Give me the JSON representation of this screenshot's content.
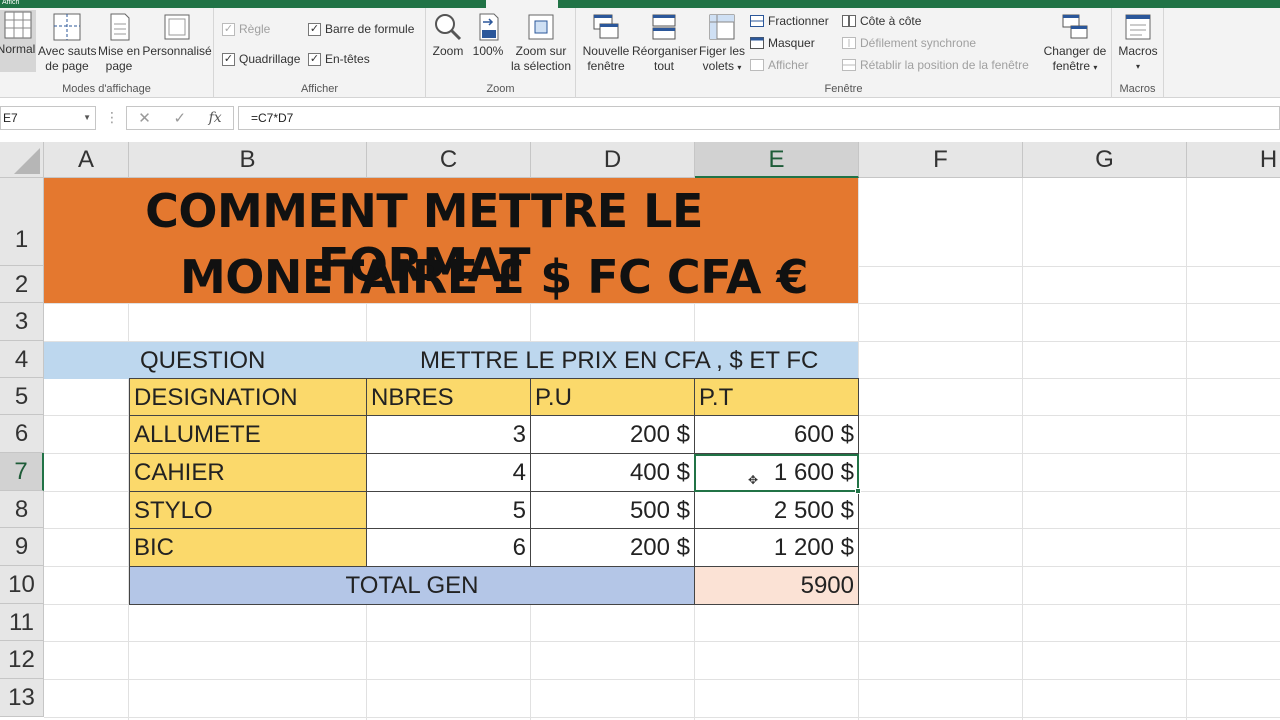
{
  "ribbon": {
    "top_tab_text": "Affich",
    "groups": {
      "modes": {
        "label": "Modes d'affichage",
        "normal": "Normal",
        "sauts_l1": "Avec sauts",
        "sauts_l2": "de page",
        "mise_l1": "Mise en",
        "mise_l2": "page",
        "perso": "Personnalisé"
      },
      "afficher": {
        "label": "Afficher",
        "regle": "Règle",
        "barre_formule": "Barre de formule",
        "quadrillage": "Quadrillage",
        "entetes": "En-têtes"
      },
      "zoom": {
        "label": "Zoom",
        "zoom": "Zoom",
        "cent": "100%",
        "sel_l1": "Zoom sur",
        "sel_l2": "la sélection"
      },
      "fenetre": {
        "label": "Fenêtre",
        "nouvelle_l1": "Nouvelle",
        "nouvelle_l2": "fenêtre",
        "reorg_l1": "Réorganiser",
        "reorg_l2": "tout",
        "figer_l1": "Figer les",
        "figer_l2": "volets",
        "fractionner": "Fractionner",
        "masquer": "Masquer",
        "afficher": "Afficher",
        "cote": "Côte à côte",
        "defilement": "Défilement synchrone",
        "retablir": "Rétablir la position de la fenêtre",
        "changer_l1": "Changer de",
        "changer_l2": "fenêtre"
      },
      "macros": {
        "label": "Macros",
        "macros": "Macros"
      }
    }
  },
  "formula_bar": {
    "name_box": "E7",
    "formula": "=C7*D7"
  },
  "columns": [
    "A",
    "B",
    "C",
    "D",
    "E",
    "F",
    "G",
    "H"
  ],
  "rows": [
    "1",
    "2",
    "3",
    "4",
    "5",
    "6",
    "7",
    "8",
    "9",
    "10",
    "11",
    "12",
    "13"
  ],
  "sheet": {
    "title_line1": "COMMENT METTRE LE FORMAT",
    "title_line2": "MONETAIRE £ $ FC CFA €",
    "question_label": "QUESTION",
    "question_text": "METTRE LE PRIX EN CFA , $ ET FC",
    "headers": [
      "DESIGNATION",
      "NBRES",
      "P.U",
      "P.T"
    ],
    "items": [
      {
        "designation": "ALLUMETE",
        "nbres": "3",
        "pu": "200 $",
        "pt": "600 $"
      },
      {
        "designation": "CAHIER",
        "nbres": "4",
        "pu": "400 $",
        "pt": "1 600 $"
      },
      {
        "designation": "STYLO",
        "nbres": "5",
        "pu": "500 $",
        "pt": "2 500 $"
      },
      {
        "designation": "BIC",
        "nbres": "6",
        "pu": "200 $",
        "pt": "1 200 $"
      }
    ],
    "total_label": "TOTAL GEN",
    "total_value": "5900"
  },
  "colors": {
    "title_bg": "#e4782f",
    "question_bg": "#bdd7ee",
    "header_bg": "#fbd96b",
    "total_bg": "#b4c6e7",
    "total_value_bg": "#fbe2d5",
    "excel_green": "#217346"
  }
}
